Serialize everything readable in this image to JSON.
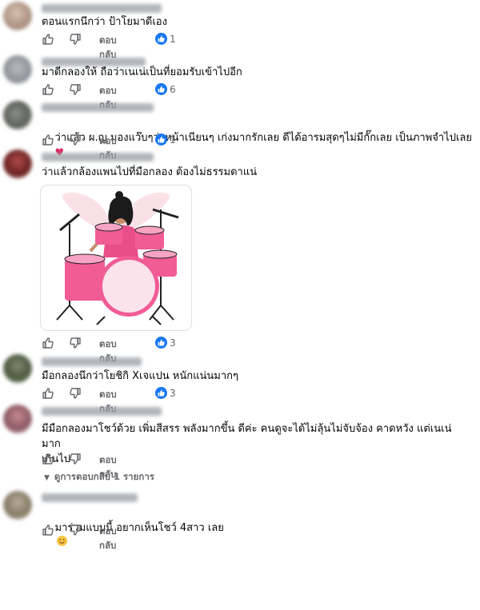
{
  "ui": {
    "reply_label": "ตอบกลับ",
    "accent": "#1877f2",
    "muted": "#65676b"
  },
  "comments": [
    {
      "text": "ตอนแรกนึกว่า ป้าโยมาดีเอง",
      "reactions": "1"
    },
    {
      "text": "มาดีกลองให้ ถือว่าเนเน่เป็นที่ยอมรับเข้าไปอีก",
      "reactions": "6"
    },
    {
      "text": "ว่าแล้ว ผ.ญ มองแว๊บๆว่าหน้าเนียนๆ เก่งมากรักเลย ดีได้อารมสุดๆไม่มีกั๊กเลย เป็นภาพจำไปเลย",
      "emoji": "♥",
      "reactions": "1"
    },
    {
      "text": "ว่าแล้วกล้องแพนไปที่มือกลอง ต้องไม่ธรรมดาแน่",
      "sticker": "drummer-sticker",
      "reactions": "3"
    },
    {
      "text": "มือกลองนึกว่าโยชิกิ Xเจแปน หนักแน่นมากๆ",
      "reactions": "3"
    },
    {
      "text": "มีมือกลองมาโชว์ด้วย เพิ่มสีสรร พลังมากขึ้น ดีค่ะ คนดูจะได้ไม่ลุ้นไม่จับจ้อง คาดหวัง แต่เนเน่ มาก\nเกินไป",
      "see_replies": "ดูการตอบกลับ 1 รายการ"
    },
    {
      "text": "มาร่วมแบบนี้ อยากเห็นโชว์ 4สาว เลย",
      "emoji": "smile"
    }
  ]
}
